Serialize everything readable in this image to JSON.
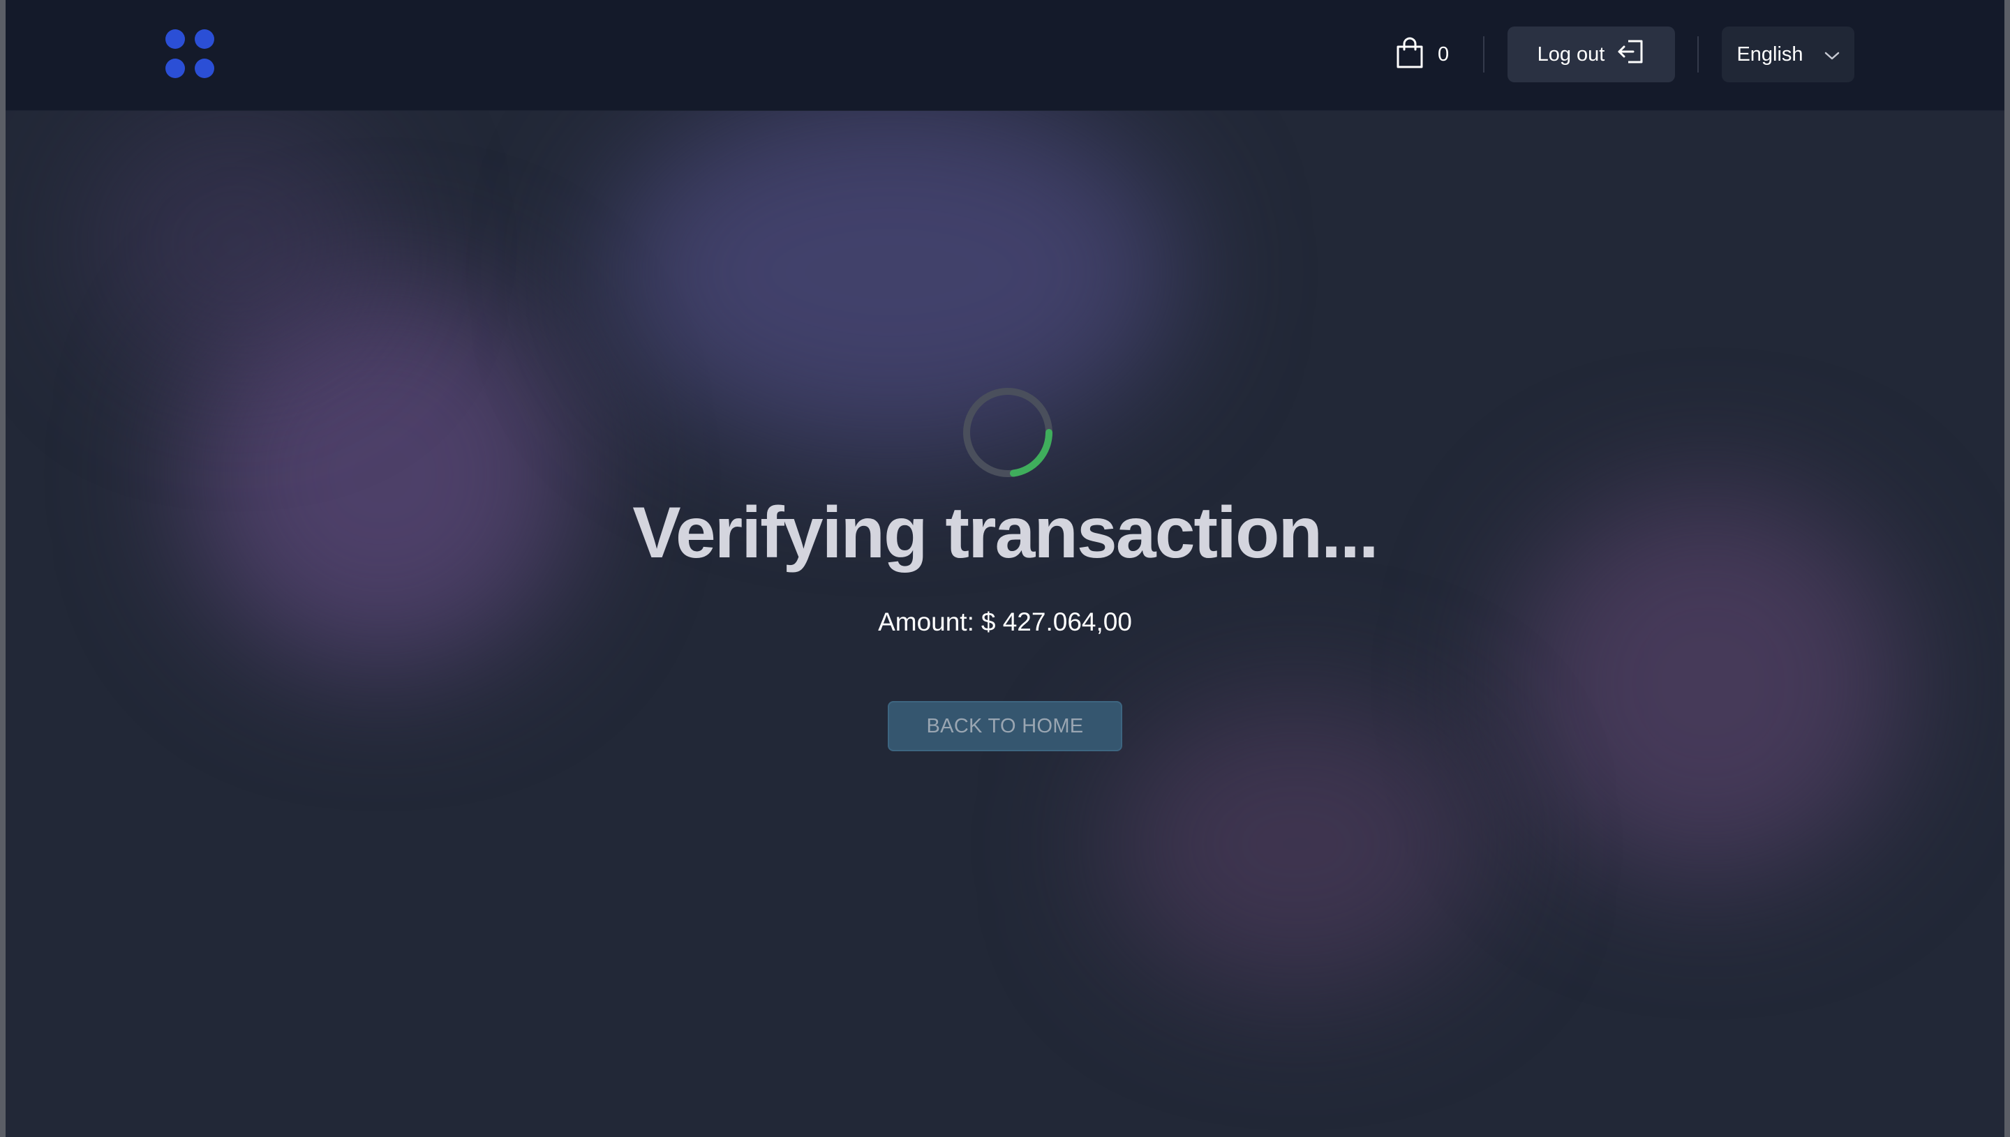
{
  "header": {
    "logo_name": "four-dots-logo",
    "cart_count": "0",
    "logout_label": "Log out",
    "language": "English"
  },
  "main": {
    "title": "Verifying transaction...",
    "amount_label": "Amount:",
    "amount_value": "$ 427.064,00",
    "back_button_label": "BACK TO HOME"
  },
  "colors": {
    "header_bg": "#141a2a",
    "page_bg": "#222837",
    "logo_blue": "#2b4fd6",
    "spinner_track": "#4a4f5c",
    "spinner_accent": "#3fae5c",
    "button_bg": "#35566f"
  }
}
